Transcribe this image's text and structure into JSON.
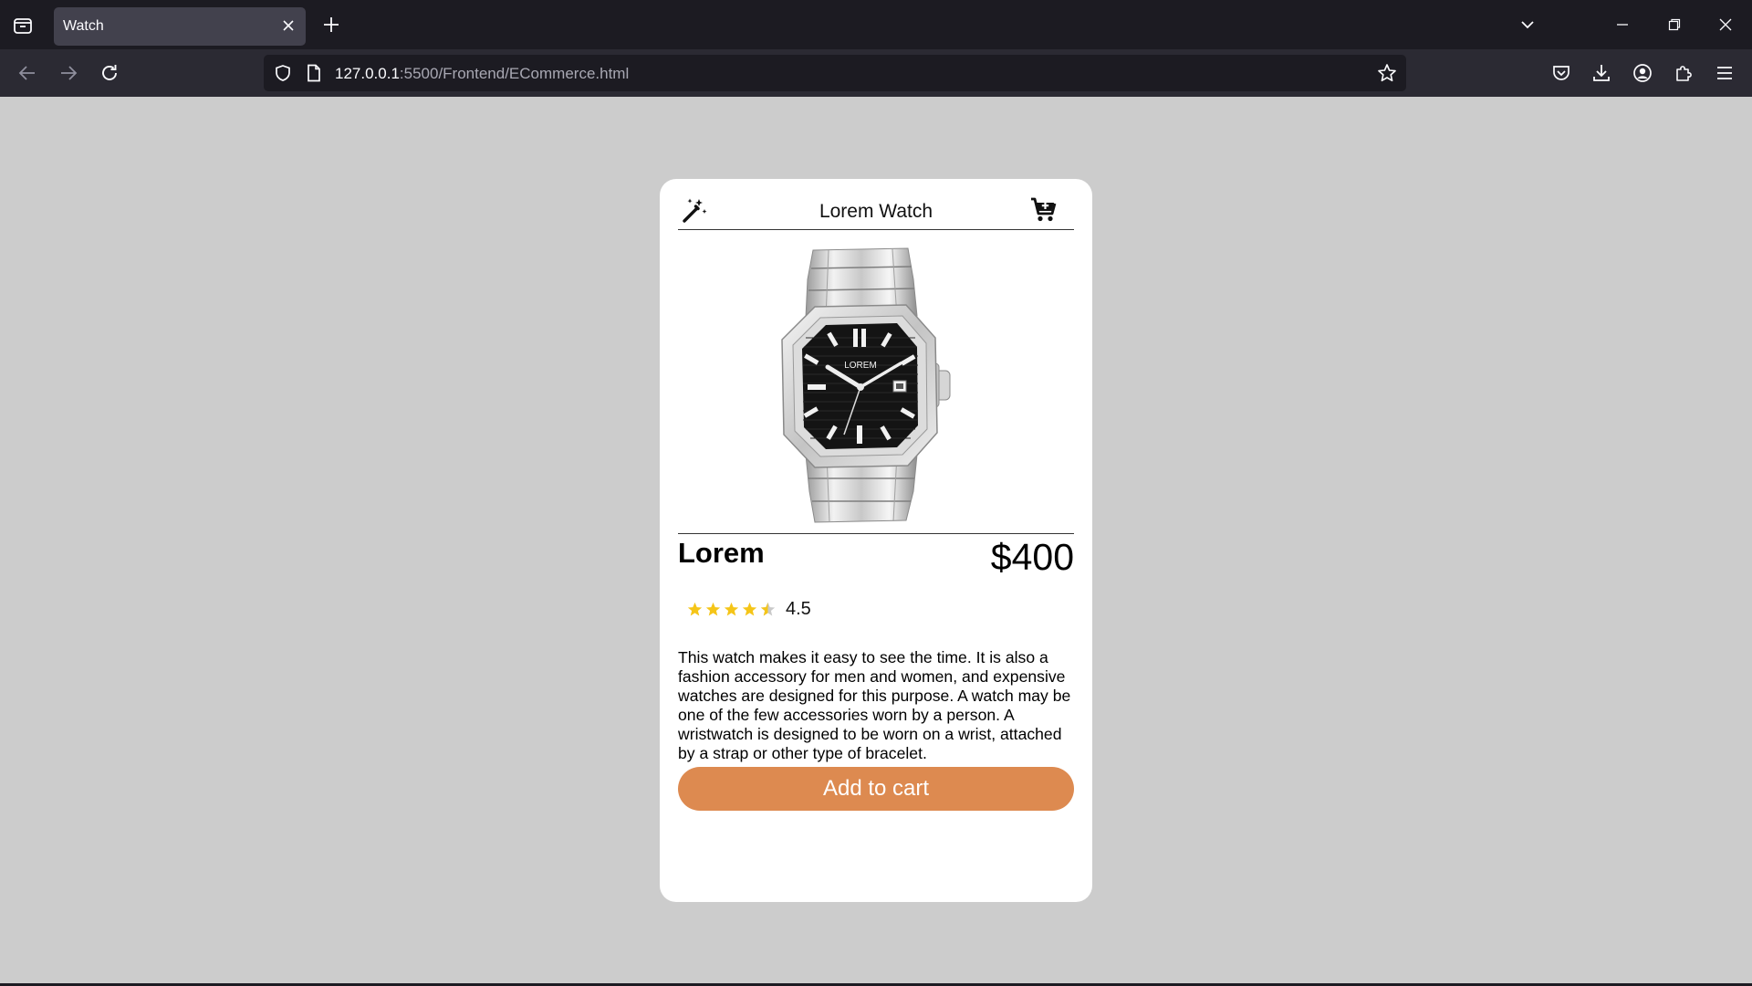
{
  "browser": {
    "tab_title": "Watch",
    "url_host": "127.0.0.1",
    "url_path": ":5500/Frontend/ECommerce.html"
  },
  "card": {
    "header_title": "Lorem Watch",
    "watch_brand": "LOREM",
    "product_name": "Lorem",
    "price": "$400",
    "rating_value": "4.5",
    "rating_stars": 4.5,
    "rating_max": 5,
    "description": "This watch makes it easy to see the time. It is also a fashion accessory for men and women, and expensive watches are designed for this purpose. A watch may be one of the few accessories worn by a person. A wristwatch is designed to be worn on a wrist, attached by a strap or other type of bracelet.",
    "button_label": "Add to cart"
  },
  "colors": {
    "page_background": "#cccccc",
    "card_background": "#ffffff",
    "button": "#dd8a50",
    "star": "#f5c518"
  }
}
